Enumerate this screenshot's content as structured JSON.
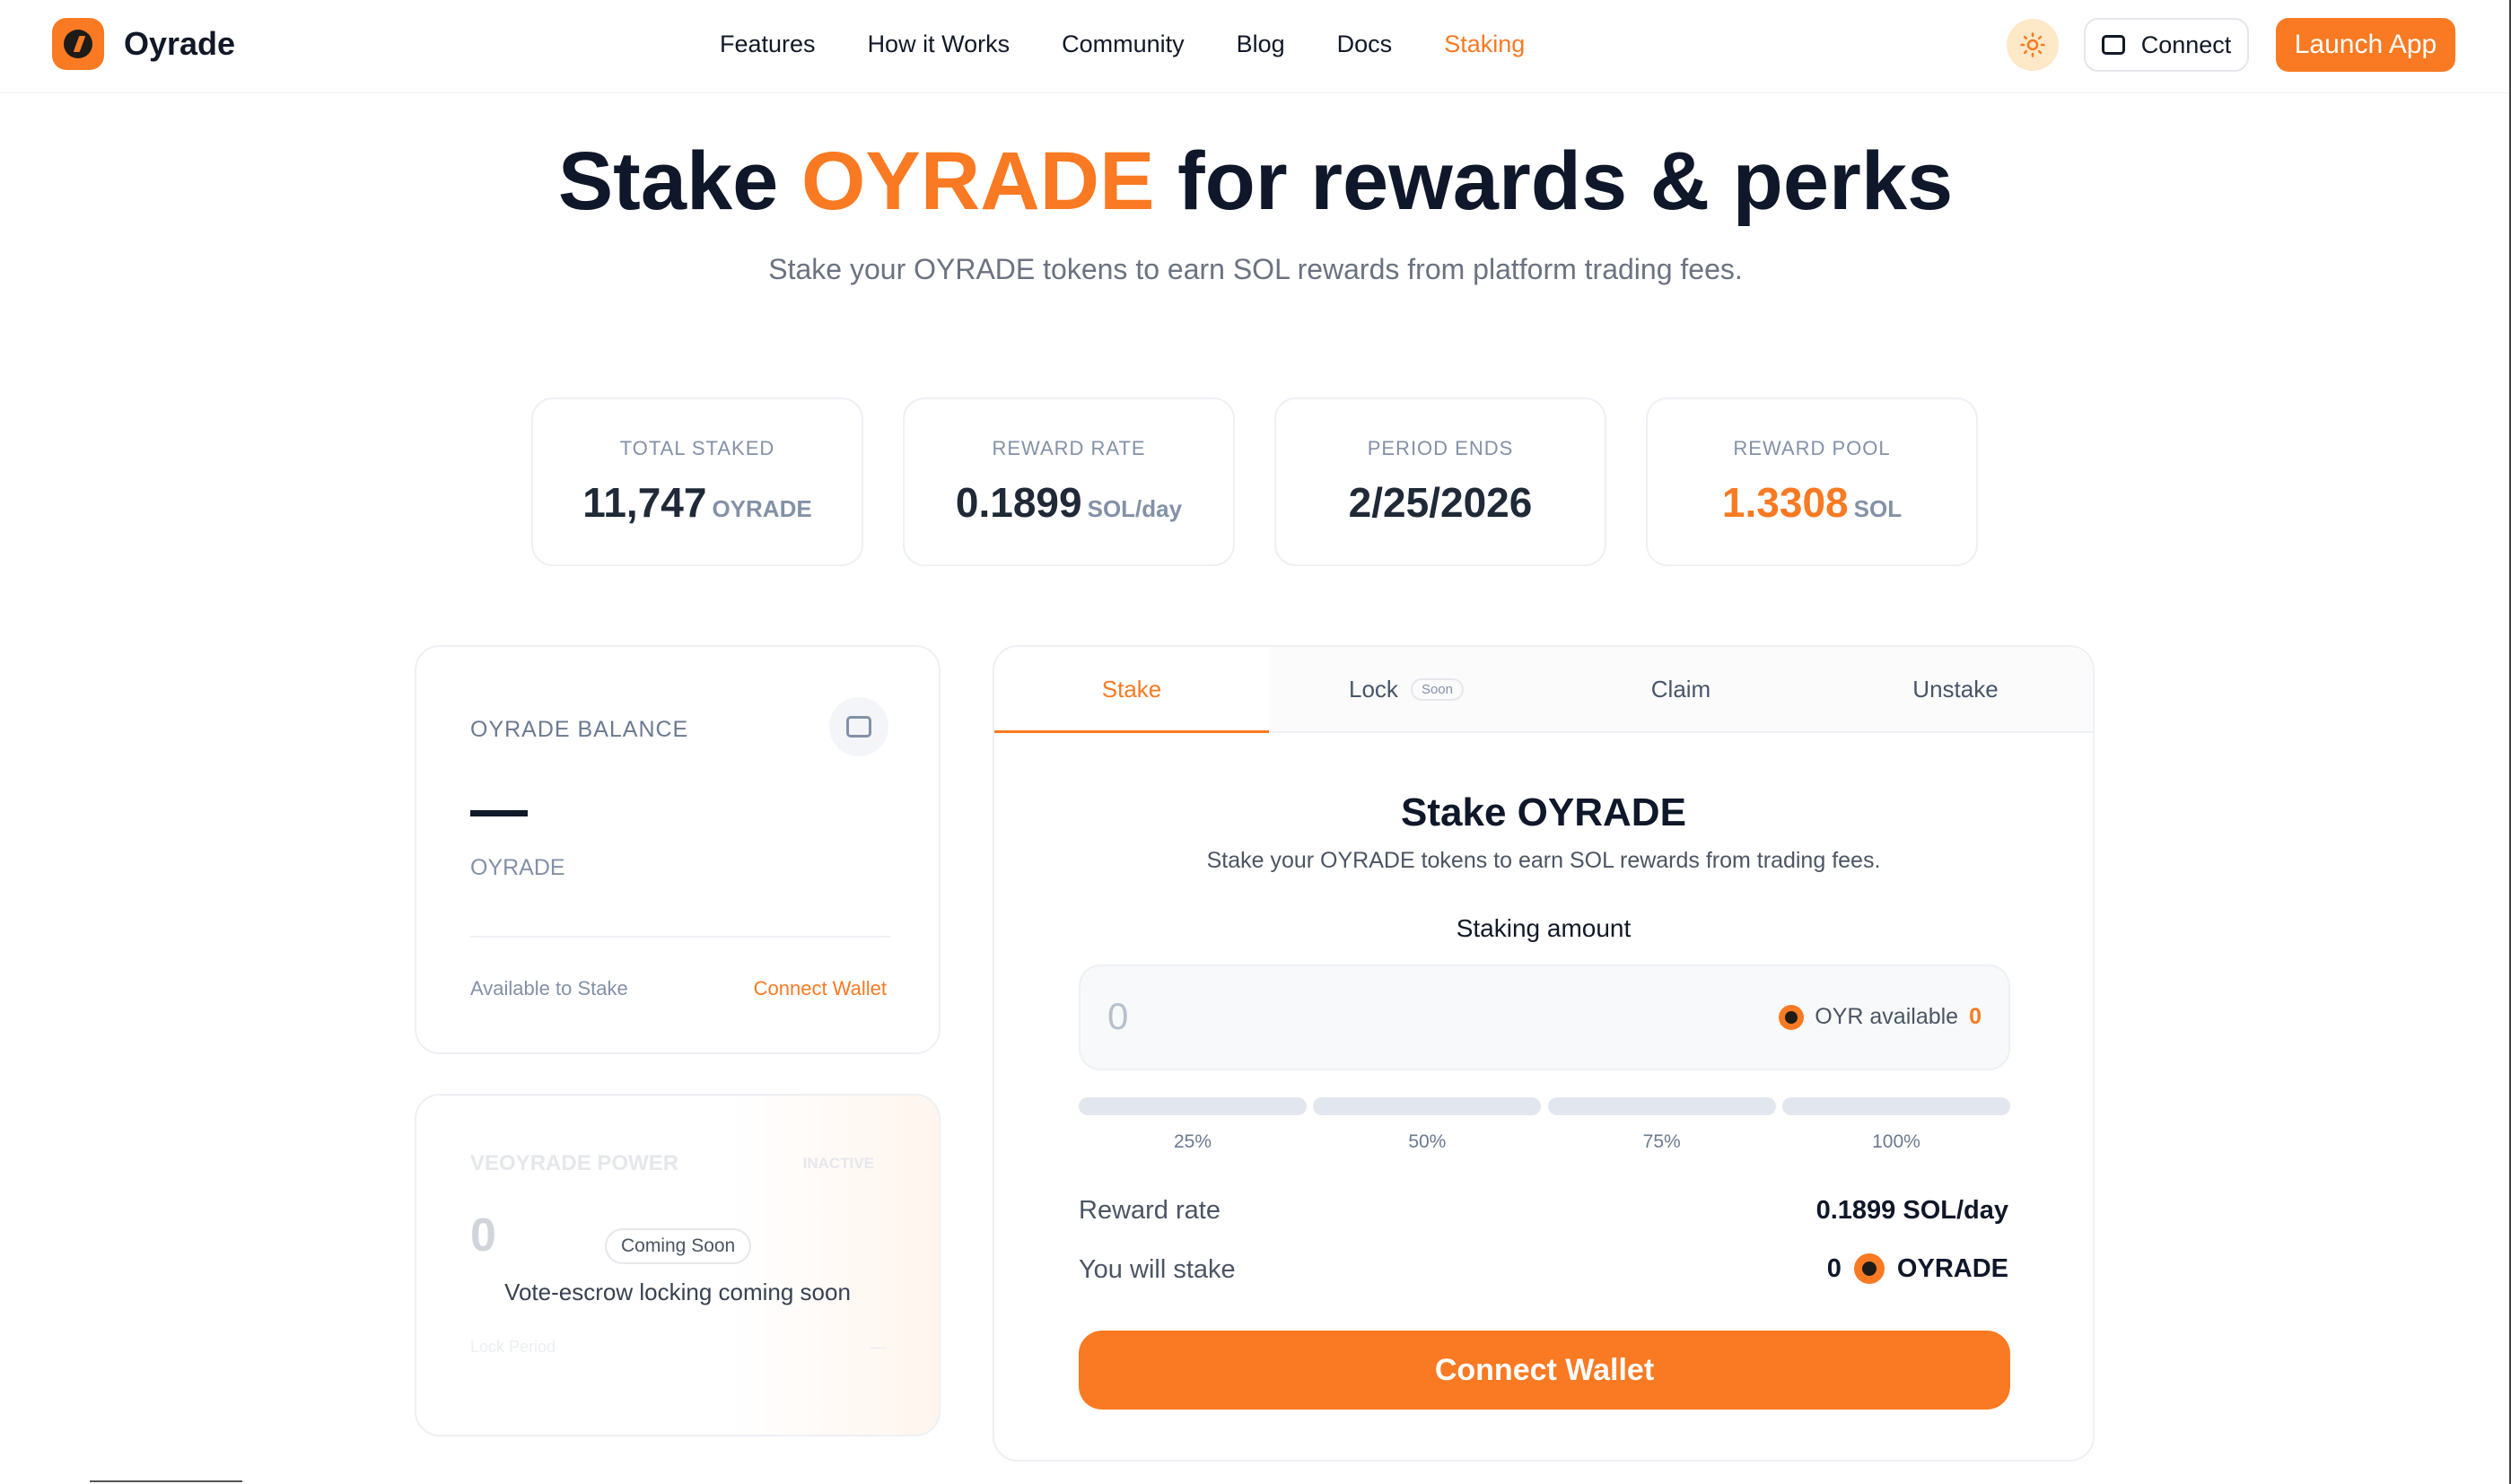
{
  "nav": {
    "brand": "Oyrade",
    "links": [
      "Features",
      "How it Works",
      "Community",
      "Blog",
      "Docs",
      "Staking"
    ],
    "active_link": "Staking",
    "connect_label": "Connect",
    "launch_label": "Launch App"
  },
  "hero": {
    "title_pre": "Stake",
    "title_accent": "OYRADE",
    "title_post": "for rewards & perks",
    "subtitle": "Stake your OYRADE tokens to earn SOL rewards from platform trading fees."
  },
  "stats": [
    {
      "label": "TOTAL STAKED",
      "value": "11,747",
      "unit": "OYRADE"
    },
    {
      "label": "REWARD RATE",
      "value": "0.1899",
      "unit": "SOL/day"
    },
    {
      "label": "PERIOD ENDS",
      "value": "2/25/2026",
      "unit": ""
    },
    {
      "label": "REWARD POOL",
      "value": "1.3308",
      "unit": "SOL"
    }
  ],
  "balance": {
    "label": "OYRADE BALANCE",
    "value": "—",
    "unit": "OYRADE",
    "available_label": "Available to Stake",
    "available_action": "Connect Wallet"
  },
  "ve": {
    "label": "VEOYRADE POWER",
    "status": "INACTIVE",
    "value": "0",
    "badge": "Coming Soon",
    "message": "Vote-escrow locking coming soon",
    "lock_label": "Lock Period",
    "lock_value": "—"
  },
  "tabs": [
    {
      "label": "Stake",
      "badge": ""
    },
    {
      "label": "Lock",
      "badge": "Soon"
    },
    {
      "label": "Claim",
      "badge": ""
    },
    {
      "label": "Unstake",
      "badge": ""
    }
  ],
  "stake": {
    "title": "Stake OYRADE",
    "subtitle": "Stake your OYRADE tokens to earn SOL rewards from trading fees.",
    "amount_label": "Staking amount",
    "amount_placeholder": "0",
    "available_label": "OYR available",
    "available_value": "0",
    "percents": [
      "25%",
      "50%",
      "75%",
      "100%"
    ],
    "reward_rate_label": "Reward rate",
    "reward_rate_value": "0.1899 SOL/day",
    "will_stake_label": "You will stake",
    "will_stake_value": "0",
    "will_stake_unit": "OYRADE",
    "cta": "Connect Wallet"
  },
  "colors": {
    "accent": "#f97a22",
    "text": "#0f172a",
    "muted": "#8391a7"
  }
}
